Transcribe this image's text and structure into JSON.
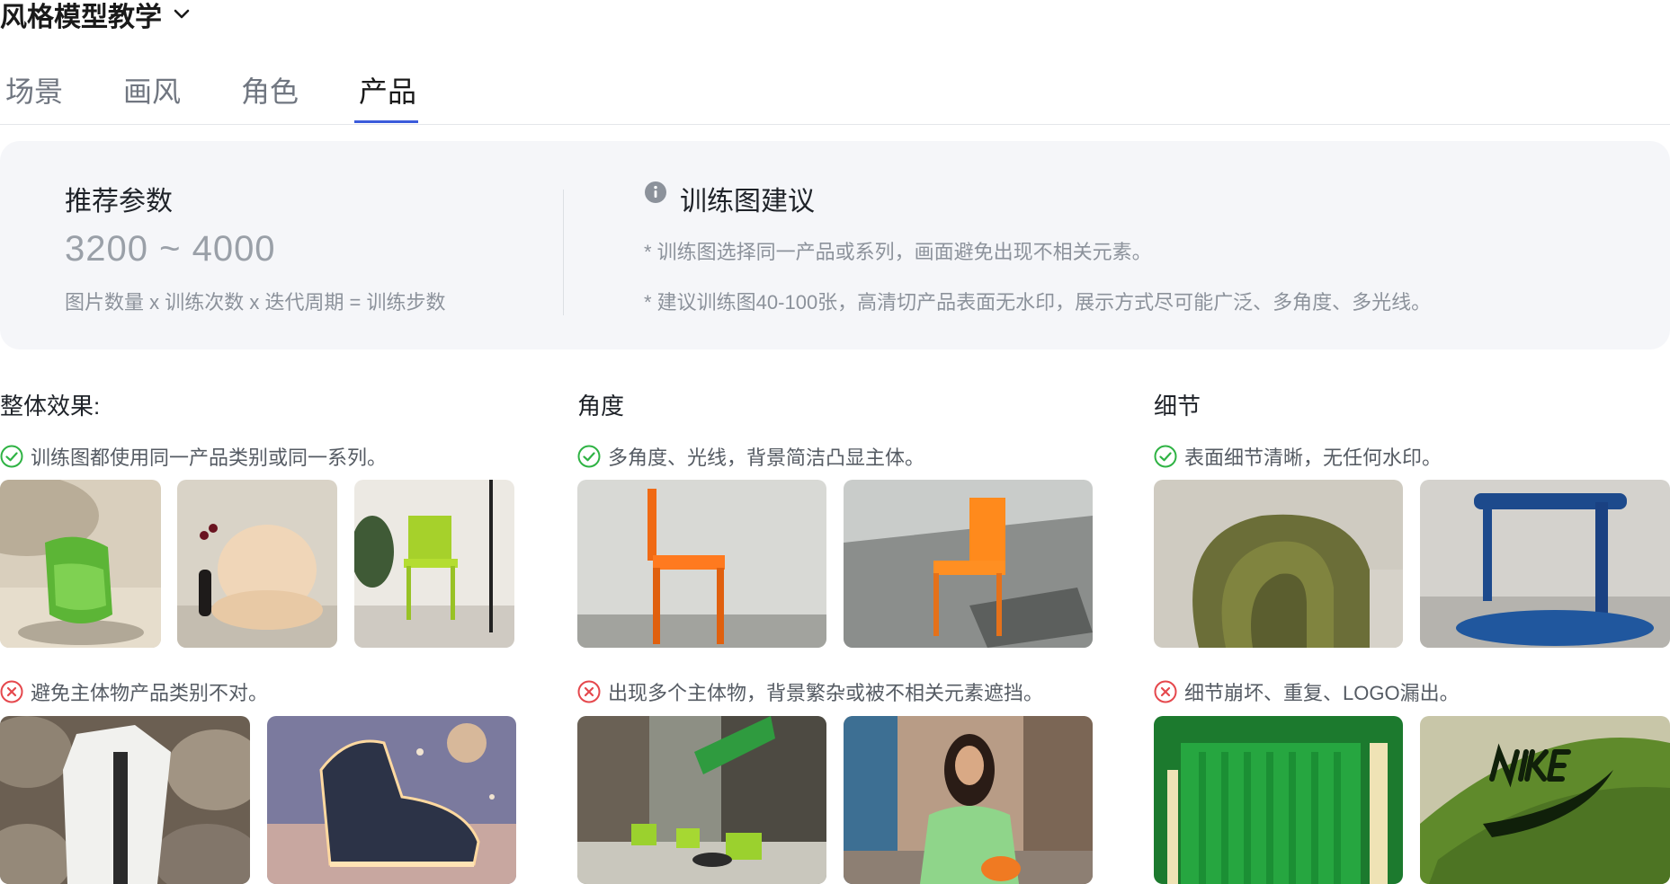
{
  "header": {
    "title": "风格模型教学",
    "dropdown_icon": "chevron-down-icon"
  },
  "tabs": [
    {
      "label": "场景",
      "active": false
    },
    {
      "label": "画风",
      "active": false
    },
    {
      "label": "角色",
      "active": false
    },
    {
      "label": "产品",
      "active": true
    }
  ],
  "params": {
    "label": "推荐参数",
    "range": "3200 ~ 4000",
    "formula": "图片数量 x 训练次数 x 迭代周期 = 训练步数"
  },
  "suggestion": {
    "title": "训练图建议",
    "icon": "info-icon",
    "items": [
      "* 训练图选择同一产品或系列，画面避免出现不相关元素。",
      "* 建议训练图40-100张，高清切产品表面无水印，展示方式尽可能广泛、多角度、多光线。"
    ]
  },
  "sections": [
    {
      "title": "整体效果:",
      "good": "训练图都使用同一产品类别或同一系列。",
      "bad": "避免主体物产品类别不对。",
      "good_images": [
        "green-armchair-on-sand-image",
        "beige-pouf-chair-image",
        "lime-green-chair-image"
      ],
      "bad_images": [
        "white-coat-on-rocks-image",
        "glowing-sneaker-image"
      ]
    },
    {
      "title": "角度",
      "good": "多角度、光线，背景简洁凸显主体。",
      "bad": "出现多个主体物，背景繁杂或被不相关元素遮挡。",
      "good_images": [
        "orange-chair-side-view-image",
        "orange-chair-shadow-image"
      ],
      "bad_images": [
        "green-chairs-street-image",
        "woman-in-street-image"
      ]
    },
    {
      "title": "细节",
      "good": "表面细节清晰，无任何水印。",
      "bad": "细节崩坏、重复、LOGO漏出。",
      "good_images": [
        "olive-chair-detail-image",
        "blue-chair-detail-image"
      ],
      "bad_images": [
        "green-chair-closeup-image",
        "nike-logo-closeup-image"
      ]
    }
  ],
  "colors": {
    "accent": "#3b5bdb",
    "good": "#2fb344",
    "bad": "#e5484d",
    "panel_bg": "#f5f6f9"
  }
}
